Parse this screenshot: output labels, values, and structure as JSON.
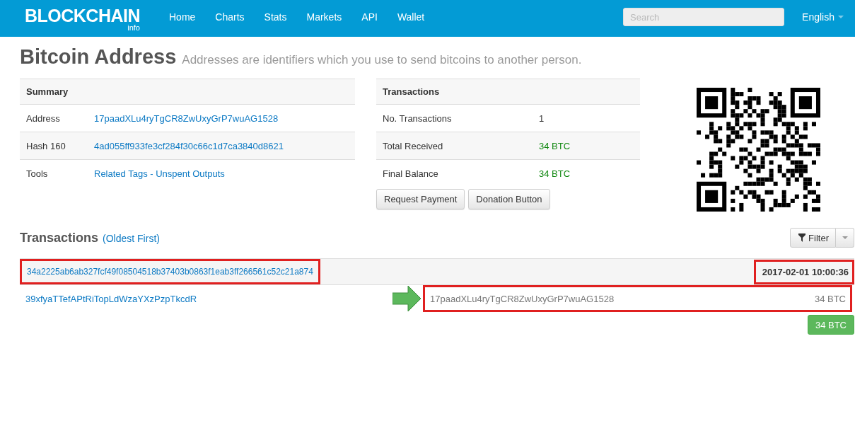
{
  "navbar": {
    "logo": "BLOCKCHAIN",
    "logo_sub": "info",
    "links": [
      {
        "label": "Home"
      },
      {
        "label": "Charts"
      },
      {
        "label": "Stats"
      },
      {
        "label": "Markets"
      },
      {
        "label": "API"
      },
      {
        "label": "Wallet"
      }
    ],
    "search": {
      "placeholder": "Search"
    },
    "language": "English"
  },
  "page": {
    "title": "Bitcoin Address",
    "subtitle": "Addresses are identifiers which you use to send bitcoins to another person."
  },
  "summary": {
    "heading": "Summary",
    "rows": [
      {
        "label": "Address",
        "value": "17paadXLu4ryTgCR8ZwUxyGrP7wuAG1528",
        "kind": "link"
      },
      {
        "label": "Hash 160",
        "value": "4ad055ff933fe3cf284f30c66c1d7ca3840d8621",
        "kind": "link"
      },
      {
        "label": "Tools",
        "value": "Related Tags - Unspent Outputs",
        "kind": "link"
      }
    ]
  },
  "transactions_summary": {
    "heading": "Transactions",
    "rows": [
      {
        "label": "No. Transactions",
        "value": "1",
        "kind": "plain"
      },
      {
        "label": "Total Received",
        "value": "34 BTC",
        "kind": "amount"
      },
      {
        "label": "Final Balance",
        "value": "34 BTC",
        "kind": "amount"
      }
    ],
    "buttons": [
      "Request Payment",
      "Donation Button"
    ]
  },
  "transactions": {
    "heading": "Transactions",
    "order": "(Oldest First)",
    "filter": "Filter",
    "items": [
      {
        "hash": "34a2225ab6ab327fcf49f08504518b37403b0863f1eab3ff266561c52c21a874",
        "hash_highlighted": true,
        "time": "2017-02-01 10:00:36",
        "time_highlighted": true,
        "input": "39xfyaTTefAPtRiTopLdWzaYXzPzpTkcdR",
        "output": "17paadXLu4ryTgCR8ZwUxyGrP7wuAG1528",
        "output_amount": "34 BTC",
        "output_highlighted": true,
        "total": "34 BTC"
      }
    ]
  }
}
